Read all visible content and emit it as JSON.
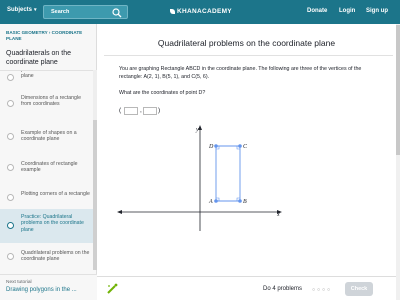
{
  "header": {
    "subjects_label": "Subjects",
    "search_placeholder": "Search",
    "logo_text": "KHANACADEMY",
    "links": [
      "Donate",
      "Login",
      "Sign up"
    ]
  },
  "sidebar": {
    "breadcrumb": "BASIC GEOMETRY › COORDINATE PLANE",
    "title": "Quadrilaterals on the coordinate plane",
    "items": [
      {
        "label": "perimeter on the coordinate plane",
        "active": false
      },
      {
        "label": "Dimensions of a rectangle from coordinates",
        "active": false
      },
      {
        "label": "Example of shapes on a coordinate plane",
        "active": false
      },
      {
        "label": "Coordinates of rectangle example",
        "active": false
      },
      {
        "label": "Plotting corners of a rectangle",
        "active": false
      },
      {
        "label": "Practice: Quadrilateral problems on the coordinate plane",
        "active": true
      },
      {
        "label": "Quadrilateral problems on the coordinate plane",
        "active": false
      }
    ],
    "next_tutorial_label": "Next tutorial",
    "next_tutorial_title": "Drawing polygons in the ..."
  },
  "main": {
    "title": "Quadrilateral problems on the coordinate plane",
    "problem_text": "You are graphing Rectangle ABCD in the coordinate plane. The following are three of the vertices of the rectangle: A(2, 1), B(5, 1), and C(5, 6).",
    "question": "What are the coordinates of point D?",
    "answer": {
      "open": "(",
      "comma": ",",
      "close": ")",
      "x_value": "",
      "y_value": ""
    },
    "graph": {
      "x_axis_label": "x",
      "y_axis_label": "y",
      "points": [
        {
          "label": "A",
          "x": 2,
          "y": 1
        },
        {
          "label": "B",
          "x": 5,
          "y": 1
        },
        {
          "label": "C",
          "x": 5,
          "y": 6
        },
        {
          "label": "D",
          "x": 2,
          "y": 6
        }
      ],
      "colors": {
        "shape": "#6495ed",
        "axis": "#21242c"
      }
    }
  },
  "footer": {
    "do_problems": "Do 4 problems",
    "progress_dots": "○ ○ ○ ○",
    "check_label": "Check"
  },
  "colors": {
    "brand": "#1c758a",
    "active_bg": "#dbe8ee",
    "check_disabled": "#cfd4d9"
  }
}
